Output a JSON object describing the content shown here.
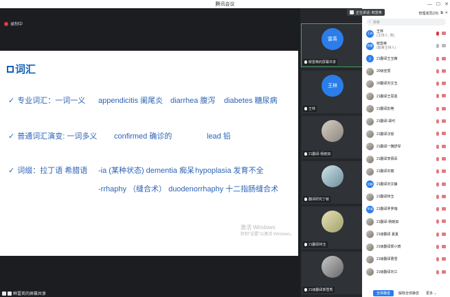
{
  "window": {
    "title": "腾讯会议"
  },
  "recording": {
    "label": "录制中"
  },
  "slide": {
    "title": "词汇",
    "lines": [
      {
        "text": "专业词汇：一词一义",
        "items": [
          "appendicitis 阑尾炎",
          "diarrhea 腹泻",
          "diabetes 糖尿病"
        ]
      },
      {
        "text": "普通词汇演变: 一词多义",
        "items": [
          "confirmed  确诊的",
          "lead 铅"
        ]
      },
      {
        "text": "词缀：拉丁语 希腊语",
        "items": [
          "-ia (某种状态) dementia 痴呆",
          "hypoplasia 发育不全"
        ]
      },
      {
        "text": "",
        "items": [
          "-rrhaphy （缝合术） duodenorrhaphy 十二指肠缝合术"
        ]
      }
    ],
    "watermark": {
      "line1": "激活 Windows",
      "line2": "转到\"设置\"以激活 Windows。"
    }
  },
  "share_bar": {
    "label": "鲜雷英的屏幕共享"
  },
  "gallery": [
    {
      "avatar": "雷英",
      "name": "鲜雷英的屏幕共享"
    },
    {
      "avatar": "王林",
      "name": "王林"
    },
    {
      "avatar": "",
      "name": "21翻译-杨婉如"
    },
    {
      "avatar": "",
      "name": "翻译研究丁敏"
    },
    {
      "avatar": "",
      "name": "21翻译林玉"
    },
    {
      "avatar": "",
      "name": "21级翻译郭雪秀"
    }
  ],
  "panel": {
    "speaking": "正在讲话: 鲜雷英",
    "manage_label": "管理成员(29)",
    "search_placeholder": "搜索",
    "participants": [
      {
        "avatar": "王林",
        "name": "王林",
        "role": "(主持人, 我)"
      },
      {
        "avatar": "鲜雷",
        "name": "鲜雷英",
        "role": "(联席主持人)"
      },
      {
        "avatar": "王",
        "name": "21翻译王玉薇",
        "role": ""
      },
      {
        "avatar": "",
        "name": "20级佳慧",
        "role": ""
      },
      {
        "avatar": "",
        "name": "20翻译刘文玉",
        "role": ""
      },
      {
        "avatar": "",
        "name": "21翻译王思嘉",
        "role": ""
      },
      {
        "avatar": "",
        "name": "21翻译彭艳",
        "role": ""
      },
      {
        "avatar": "",
        "name": "21翻译-胡可",
        "role": ""
      },
      {
        "avatar": "",
        "name": "21翻译汉俊",
        "role": ""
      },
      {
        "avatar": "",
        "name": "21翻译一魏舒琴",
        "role": ""
      },
      {
        "avatar": "",
        "name": "21翻译李佩凤",
        "role": ""
      },
      {
        "avatar": "",
        "name": "21翻译刘丽",
        "role": ""
      },
      {
        "avatar": "文静",
        "name": "21翻译刘文静",
        "role": ""
      },
      {
        "avatar": "",
        "name": "21翻译林玉",
        "role": ""
      },
      {
        "avatar": "罗瑞",
        "name": "21翻译罗罗瑞",
        "role": ""
      },
      {
        "avatar": "",
        "name": "21翻译-杨婉如",
        "role": ""
      },
      {
        "avatar": "",
        "name": "21级翻译 夏夏",
        "role": ""
      },
      {
        "avatar": "",
        "name": "21级翻译郭小琦",
        "role": ""
      },
      {
        "avatar": "",
        "name": "21级翻译曹雪",
        "role": ""
      },
      {
        "avatar": "",
        "name": "21级翻译刘江",
        "role": ""
      }
    ],
    "footer": {
      "mute_all": "全体静音",
      "unmute_all": "解除全体静音",
      "more": "更多"
    }
  }
}
